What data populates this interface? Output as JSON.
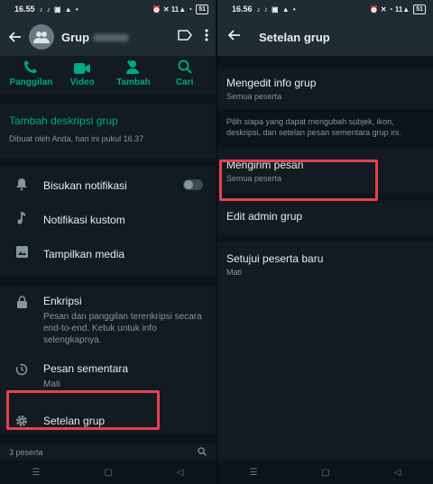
{
  "left": {
    "status": {
      "time": "16.55",
      "icons_left": "♪ ♪ ▣ ▲ •",
      "icons_right": "⏰ ✕ 11▲ ◔",
      "battery": "51"
    },
    "header": {
      "title": "Grup"
    },
    "actions": [
      {
        "label": "Panggilan",
        "icon": "phone-icon"
      },
      {
        "label": "Video",
        "icon": "video-icon"
      },
      {
        "label": "Tambah",
        "icon": "add-person-icon"
      },
      {
        "label": "Cari",
        "icon": "search-icon"
      }
    ],
    "description": {
      "add_label": "Tambah deskripsi grup",
      "created_by": "Dibuat oleh Anda, hari ini pukul 16.37"
    },
    "rows": {
      "mute": "Bisukan notifikasi",
      "custom_notif": "Notifikasi kustom",
      "media": "Tampilkan media",
      "encryption": "Enkripsi",
      "encryption_sub": "Pesan dan panggilan terenkripsi secara end-to-end. Ketuk untuk info selengkapnya.",
      "disappearing": "Pesan sementara",
      "disappearing_sub": "Mati",
      "group_settings": "Setelan grup"
    },
    "participants": "3 peserta",
    "highlight_color": "#e5404f",
    "accent_color": "#00a884"
  },
  "right": {
    "status": {
      "time": "16.56",
      "icons_left": "♪ ♪ ▣ ▲ •",
      "icons_right": "⏰ ✕ ◔ 11▲",
      "battery": "51"
    },
    "header": {
      "title": "Setelan grup"
    },
    "edit_info": {
      "label": "Mengedit info grup",
      "sub": "Semua peserta"
    },
    "note": "Pilih siapa yang dapat mengubah subjek, ikon, deskripsi, dan setelan pesan sementara grup ini.",
    "send_messages": {
      "label": "Mengirim pesan",
      "sub": "Semua peserta"
    },
    "edit_admins": {
      "label": "Edit admin grup"
    },
    "approve": {
      "label": "Setujui peserta baru",
      "sub": "Mati"
    }
  }
}
